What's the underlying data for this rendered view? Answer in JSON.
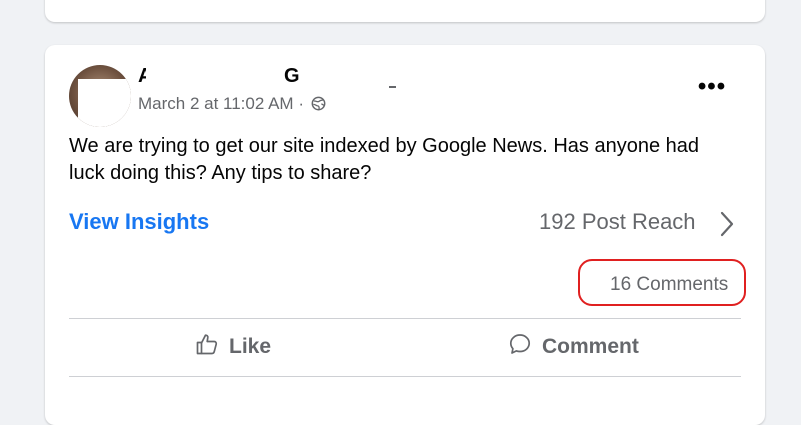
{
  "post": {
    "author_initial_first": "Al",
    "author_initial_last": "G",
    "timestamp": "March 2 at 11:02 AM",
    "separator": " · ",
    "audience_icon": "globe-icon",
    "more_icon": "more-options-icon",
    "more_label": "•••",
    "text": "We are trying to get our site indexed by Google News. Has anyone had luck doing this? Any tips to share?"
  },
  "stats": {
    "insights_label": "View Insights",
    "reach_label": "192 Post Reach",
    "comments_label": "16 Comments"
  },
  "actions": {
    "like_label": "Like",
    "comment_label": "Comment"
  },
  "colors": {
    "link_blue": "#1877f2",
    "secondary_text": "#65676b",
    "highlight_red": "#e02020",
    "background": "#f0f2f5"
  }
}
